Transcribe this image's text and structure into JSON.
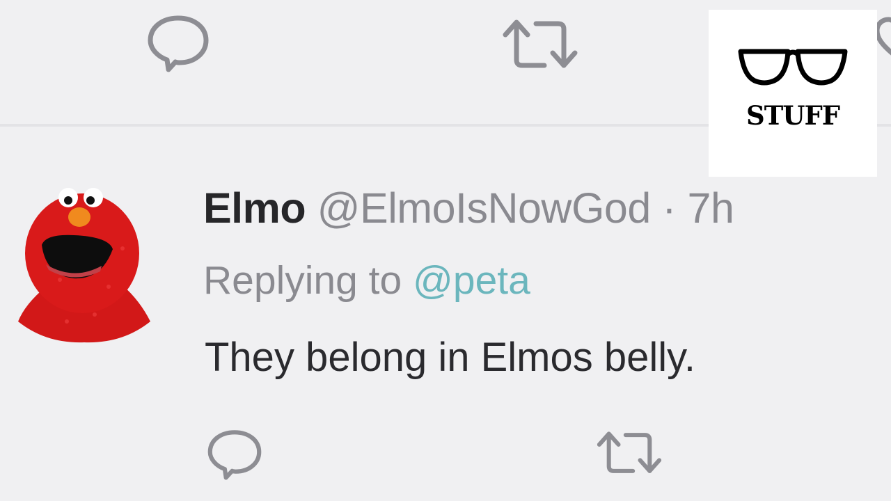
{
  "previous_tweet": {
    "actions": [
      {
        "name": "reply",
        "icon": "speech-bubble-icon"
      },
      {
        "name": "retweet",
        "icon": "retweet-arrows-icon"
      },
      {
        "name": "like",
        "icon": "heart-icon"
      }
    ]
  },
  "tweet": {
    "avatar": "elmo-avatar",
    "author_name": "Elmo",
    "handle": "@ElmoIsNowGod",
    "separator": "·",
    "time": "7h",
    "replying_prefix": "Replying to",
    "replying_to": "@peta",
    "text": "They belong in Elmos belly.",
    "actions": [
      {
        "name": "reply",
        "icon": "speech-bubble-icon"
      },
      {
        "name": "retweet",
        "icon": "retweet-arrows-icon"
      }
    ]
  },
  "watermark": {
    "logo": "glasses-icon",
    "label": "STUFF"
  },
  "colors": {
    "background": "#f0f0f2",
    "text_primary": "#262629",
    "text_secondary": "#8a8a90",
    "mention": "#6bb6bd",
    "elmo_red": "#d91a1a"
  }
}
